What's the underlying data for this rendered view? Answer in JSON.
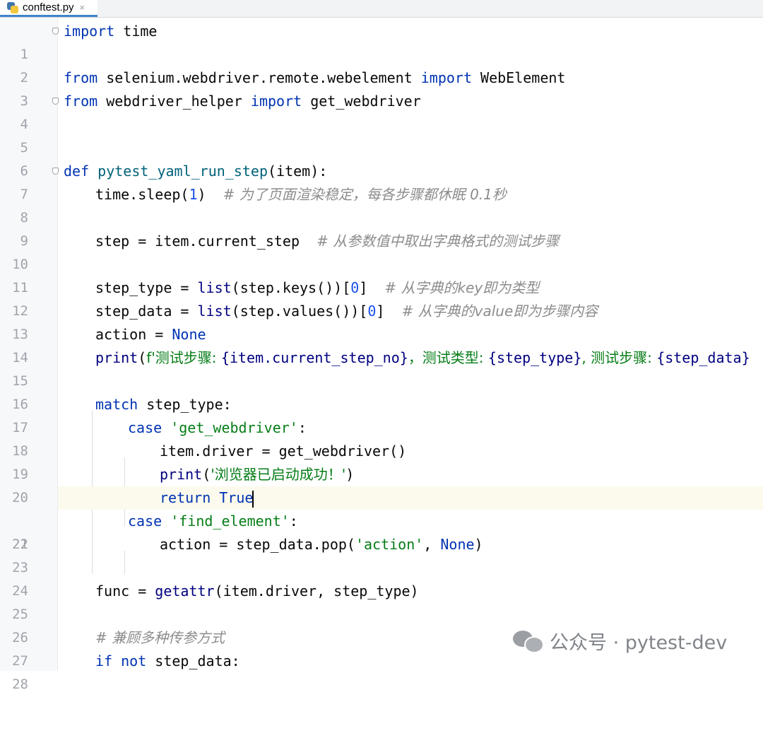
{
  "tab": {
    "filename": "conftest.py",
    "close_glyph": "×"
  },
  "editor": {
    "current_line": 21
  },
  "lines": [
    {
      "n": "1"
    },
    {
      "n": "2"
    },
    {
      "n": "3"
    },
    {
      "n": "4"
    },
    {
      "n": "5"
    },
    {
      "n": "6"
    },
    {
      "n": "7"
    },
    {
      "n": "8"
    },
    {
      "n": "9"
    },
    {
      "n": "10"
    },
    {
      "n": "11"
    },
    {
      "n": "12"
    },
    {
      "n": "13"
    },
    {
      "n": "14"
    },
    {
      "n": "15"
    },
    {
      "n": "16"
    },
    {
      "n": "17"
    },
    {
      "n": "18"
    },
    {
      "n": "19"
    },
    {
      "n": "20"
    },
    {
      "n": "21"
    },
    {
      "n": "22"
    },
    {
      "n": "23"
    },
    {
      "n": "24"
    },
    {
      "n": "25"
    },
    {
      "n": "26"
    },
    {
      "n": "27"
    },
    {
      "n": "28"
    }
  ],
  "code": {
    "l1": {
      "kw": "import",
      "rest": " time"
    },
    "l3": {
      "kw1": "from",
      "mod": " selenium.webdriver.remote.webelement ",
      "kw2": "import",
      "rest": " WebElement"
    },
    "l4": {
      "kw1": "from",
      "mod": " webdriver_helper ",
      "kw2": "import",
      "rest": " get_webdriver"
    },
    "l7": {
      "kw": "def",
      "sp": " ",
      "fn": "pytest_yaml_run_step",
      "rest": "(item):"
    },
    "l8": {
      "a": "time.sleep(",
      "num": "1",
      "b": ")  ",
      "cm": "# 为了页面渲染稳定，每各步骤都休眠 0.1秒"
    },
    "l10": {
      "a": "step = item.current_step  ",
      "cm": "# 从参数值中取出字典格式的测试步骤"
    },
    "l12": {
      "a": "step_type = ",
      "bi": "list",
      "b": "(step.keys())[",
      "num": "0",
      "c": "]  ",
      "cm": "# 从字典的key即为类型"
    },
    "l13": {
      "a": "step_data = ",
      "bi": "list",
      "b": "(step.values())[",
      "num": "0",
      "c": "]  ",
      "cm": "# 从字典的value即为步骤内容"
    },
    "l14": {
      "a": "action = ",
      "kw": "None"
    },
    "l15": {
      "bi": "print",
      "a": "(",
      "s1": "f'测试步骤: ",
      "v1": "{item.current_step_no}",
      "s2": "，测试类型: ",
      "v2": "{step_type}",
      "s3": ", 测试步骤: ",
      "v3": "{step_data}"
    },
    "l17": {
      "kw": "match",
      "rest": " step_type:"
    },
    "l18": {
      "kw": "case",
      "sp": " ",
      "str": "'get_webdriver'",
      "rest": ":"
    },
    "l19": {
      "a": "item.driver = get_webdriver()"
    },
    "l20": {
      "bi": "print",
      "a": "(",
      "str": "'浏览器已启动成功！'",
      "b": ")"
    },
    "l21": {
      "kw": "return",
      "sp": " ",
      "kw2": "True"
    },
    "l22": {
      "kw": "case",
      "sp": " ",
      "str": "'find_element'",
      "rest": ":"
    },
    "l23": {
      "a": "action = step_data.pop(",
      "str": "'action'",
      "b": ", ",
      "kw": "None",
      "c": ")"
    },
    "l25": {
      "a": "func = ",
      "bi": "getattr",
      "b": "(item.driver, step_type)"
    },
    "l27": {
      "cm": "# 兼顾多种传参方式"
    },
    "l28": {
      "kw1": "if",
      "sp1": " ",
      "kw2": "not",
      "rest": " step_data:"
    }
  },
  "watermark": {
    "text": "公众号 · pytest-dev",
    "icon": "wechat-icon"
  }
}
